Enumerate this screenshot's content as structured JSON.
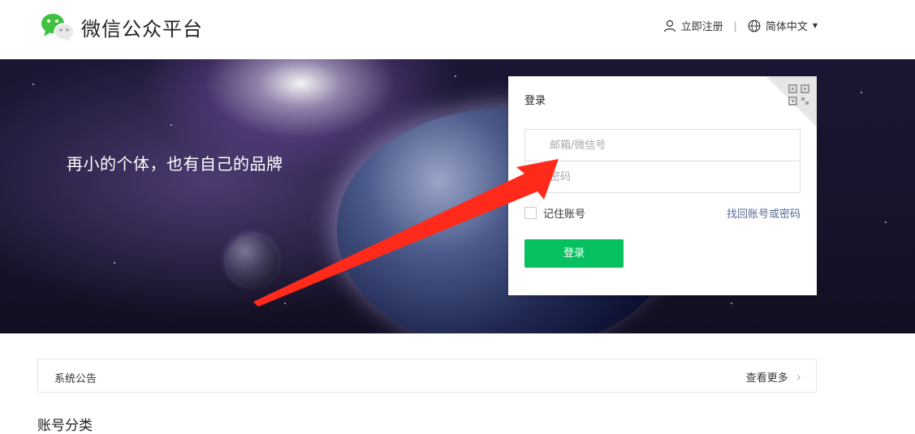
{
  "header": {
    "logo_text": "微信公众平台",
    "register_label": "立即注册",
    "language_label": "简体中文"
  },
  "banner": {
    "slogan": "再小的个体，也有自己的品牌"
  },
  "login": {
    "title": "登录",
    "account_placeholder": "邮箱/微信号",
    "password_placeholder": "密码",
    "remember_label": "记住账号",
    "forgot_label": "找回账号或密码",
    "submit_label": "登录"
  },
  "notice": {
    "title": "系统公告",
    "more_label": "查看更多"
  },
  "section": {
    "title": "账号分类"
  },
  "colors": {
    "brand_green": "#07c160",
    "link_blue": "#576b95",
    "annotation_red": "#ff2a1a"
  },
  "icons": [
    "wechat-logo-icon",
    "user-icon",
    "globe-icon",
    "qr-code-icon",
    "chevron-right-icon"
  ]
}
